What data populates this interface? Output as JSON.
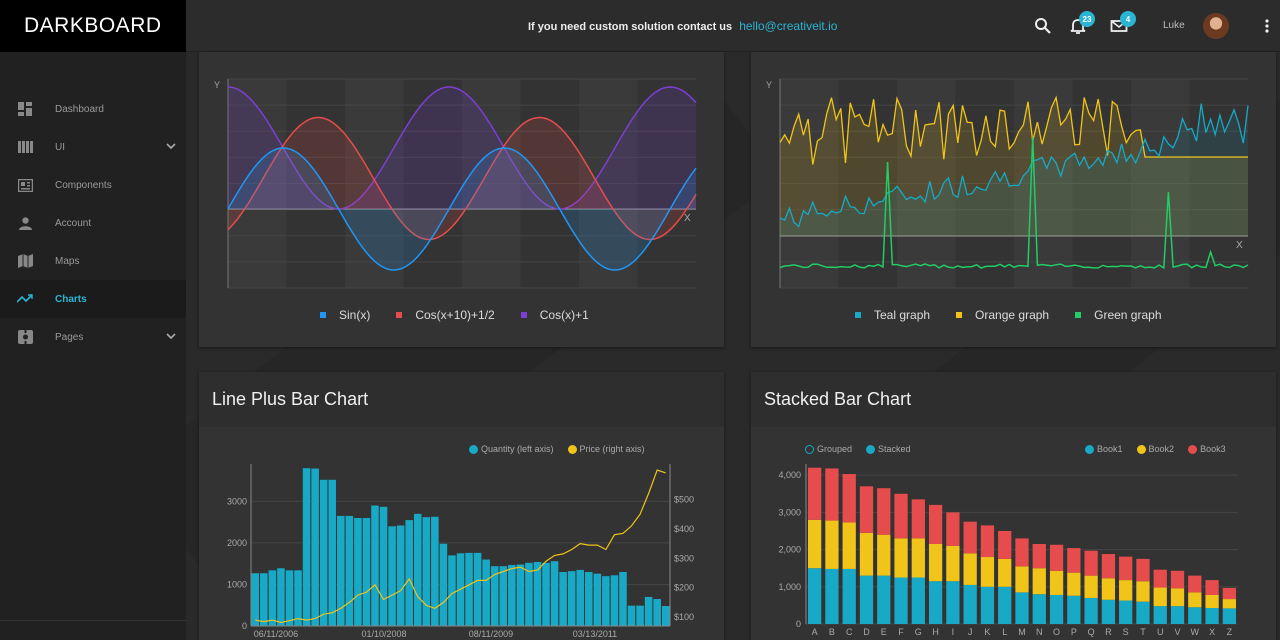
{
  "app": {
    "brand": "DARKBOARD"
  },
  "topbar": {
    "contact_text": "If you need custom solution contact us",
    "contact_email": "hello@creativeit.io",
    "notifications_count": "23",
    "messages_count": "4",
    "user_name": "Luke"
  },
  "sidebar": {
    "items": [
      {
        "label": "Dashboard",
        "icon": "dashboard-icon"
      },
      {
        "label": "UI",
        "icon": "ui-icon"
      },
      {
        "label": "Components",
        "icon": "components-icon"
      },
      {
        "label": "Account",
        "icon": "account-icon"
      },
      {
        "label": "Maps",
        "icon": "map-icon"
      },
      {
        "label": "Charts",
        "icon": "chart-icon"
      },
      {
        "label": "Pages",
        "icon": "pages-icon"
      }
    ],
    "active_label": "Charts"
  },
  "colors": {
    "accent": "#2ab5d4",
    "teal": "#17a9c6",
    "orange": "#f0c419",
    "green": "#22cc66",
    "red": "#e74c4c",
    "purple": "#7b3fd4",
    "blue": "#2196f3"
  },
  "chart_data": [
    {
      "type": "line",
      "xlabel": "X",
      "ylabel": "Y",
      "series": [
        {
          "name": "Sin(x)",
          "color": "#2196f3",
          "fn": "sin"
        },
        {
          "name": "Cos(x+10)+1/2",
          "color": "#e74c4c",
          "fn": "cos10"
        },
        {
          "name": "Cos(x)+1",
          "color": "#7b3fd4",
          "fn": "cos1"
        }
      ]
    },
    {
      "type": "line",
      "xlabel": "X",
      "ylabel": "Y",
      "series": [
        {
          "name": "Teal graph",
          "color": "#17a9c6"
        },
        {
          "name": "Orange graph",
          "color": "#f0c419"
        },
        {
          "name": "Green graph",
          "color": "#22cc66"
        }
      ]
    },
    {
      "type": "bar",
      "title": "Line Plus Bar Chart",
      "series_names": {
        "bars": "Quantity (left axis)",
        "line": "Price (right axis)"
      },
      "x_ticks": [
        "06/11/2006",
        "01/10/2008",
        "08/11/2009",
        "03/13/2011"
      ],
      "y_left_ticks": [
        "0",
        "1000",
        "2000",
        "3000"
      ],
      "y_right_ticks": [
        "$100",
        "$200",
        "$300",
        "$400",
        "$500"
      ],
      "bars": [
        1270,
        1270,
        1340,
        1390,
        1340,
        1340,
        3800,
        3790,
        3520,
        3520,
        2650,
        2650,
        2600,
        2600,
        2900,
        2870,
        2400,
        2420,
        2550,
        2700,
        2620,
        2630,
        1980,
        1700,
        1750,
        1760,
        1760,
        1600,
        1440,
        1440,
        1470,
        1480,
        1520,
        1540,
        1520,
        1560,
        1300,
        1320,
        1350,
        1300,
        1260,
        1200,
        1220,
        1300,
        490,
        490,
        700,
        650,
        480
      ],
      "price": [
        90,
        85,
        90,
        82,
        88,
        95,
        90,
        95,
        110,
        115,
        130,
        150,
        175,
        185,
        210,
        160,
        175,
        190,
        230,
        170,
        140,
        130,
        150,
        180,
        195,
        210,
        225,
        225,
        245,
        255,
        265,
        270,
        255,
        260,
        290,
        310,
        315,
        330,
        350,
        345,
        345,
        330,
        380,
        385,
        410,
        450,
        520,
        600,
        590
      ]
    },
    {
      "type": "bar",
      "title": "Stacked Bar Chart",
      "controls": [
        "Grouped",
        "Stacked"
      ],
      "categories": [
        "A",
        "B",
        "C",
        "D",
        "E",
        "F",
        "G",
        "H",
        "I",
        "J",
        "K",
        "L",
        "M",
        "N",
        "O",
        "P",
        "Q",
        "R",
        "S",
        "T",
        "U",
        "V",
        "W",
        "X",
        "Z"
      ],
      "y_ticks": [
        "0",
        "1,000",
        "2,000",
        "3,000",
        "4,000"
      ],
      "series": [
        {
          "name": "Book1",
          "color": "#17a9c6",
          "values": [
            1500,
            1480,
            1480,
            1300,
            1300,
            1250,
            1250,
            1150,
            1150,
            1050,
            1000,
            1000,
            850,
            800,
            780,
            760,
            700,
            650,
            630,
            600,
            480,
            480,
            450,
            430,
            420
          ]
        },
        {
          "name": "Book2",
          "color": "#f0c419",
          "values": [
            1300,
            1300,
            1250,
            1150,
            1100,
            1050,
            1050,
            1000,
            950,
            850,
            800,
            750,
            700,
            700,
            650,
            620,
            600,
            580,
            550,
            550,
            500,
            480,
            400,
            350,
            250
          ]
        },
        {
          "name": "Book3",
          "color": "#e74c4c",
          "values": [
            1400,
            1400,
            1300,
            1250,
            1250,
            1200,
            1050,
            1050,
            900,
            850,
            850,
            750,
            750,
            650,
            700,
            660,
            670,
            650,
            630,
            600,
            480,
            470,
            450,
            400,
            300
          ]
        }
      ]
    }
  ]
}
